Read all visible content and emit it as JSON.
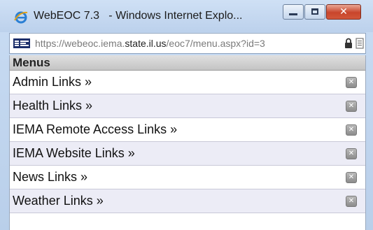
{
  "window": {
    "title": "WebEOC 7.3   - Windows Internet Explo...",
    "controls": {
      "minimize_icon": "minimize-icon",
      "maximize_icon": "maximize-icon",
      "close_glyph": "✕"
    }
  },
  "address_bar": {
    "url_prefix": "https://webeoc.iema.",
    "url_host": "state.il.us",
    "url_suffix": "/eoc7/menu.aspx?id=3"
  },
  "menus": {
    "title": "Menus",
    "items": [
      {
        "label": "Admin Links »"
      },
      {
        "label": "Health Links »"
      },
      {
        "label": "IEMA Remote Access Links »"
      },
      {
        "label": "IEMA Website Links »"
      },
      {
        "label": "News Links »"
      },
      {
        "label": "Weather Links »"
      }
    ],
    "remove_glyph": "✕"
  },
  "colors": {
    "header_bg": "#d3d3d3",
    "row_alt_bg": "#ececf6",
    "close_button": "#c8452b"
  }
}
